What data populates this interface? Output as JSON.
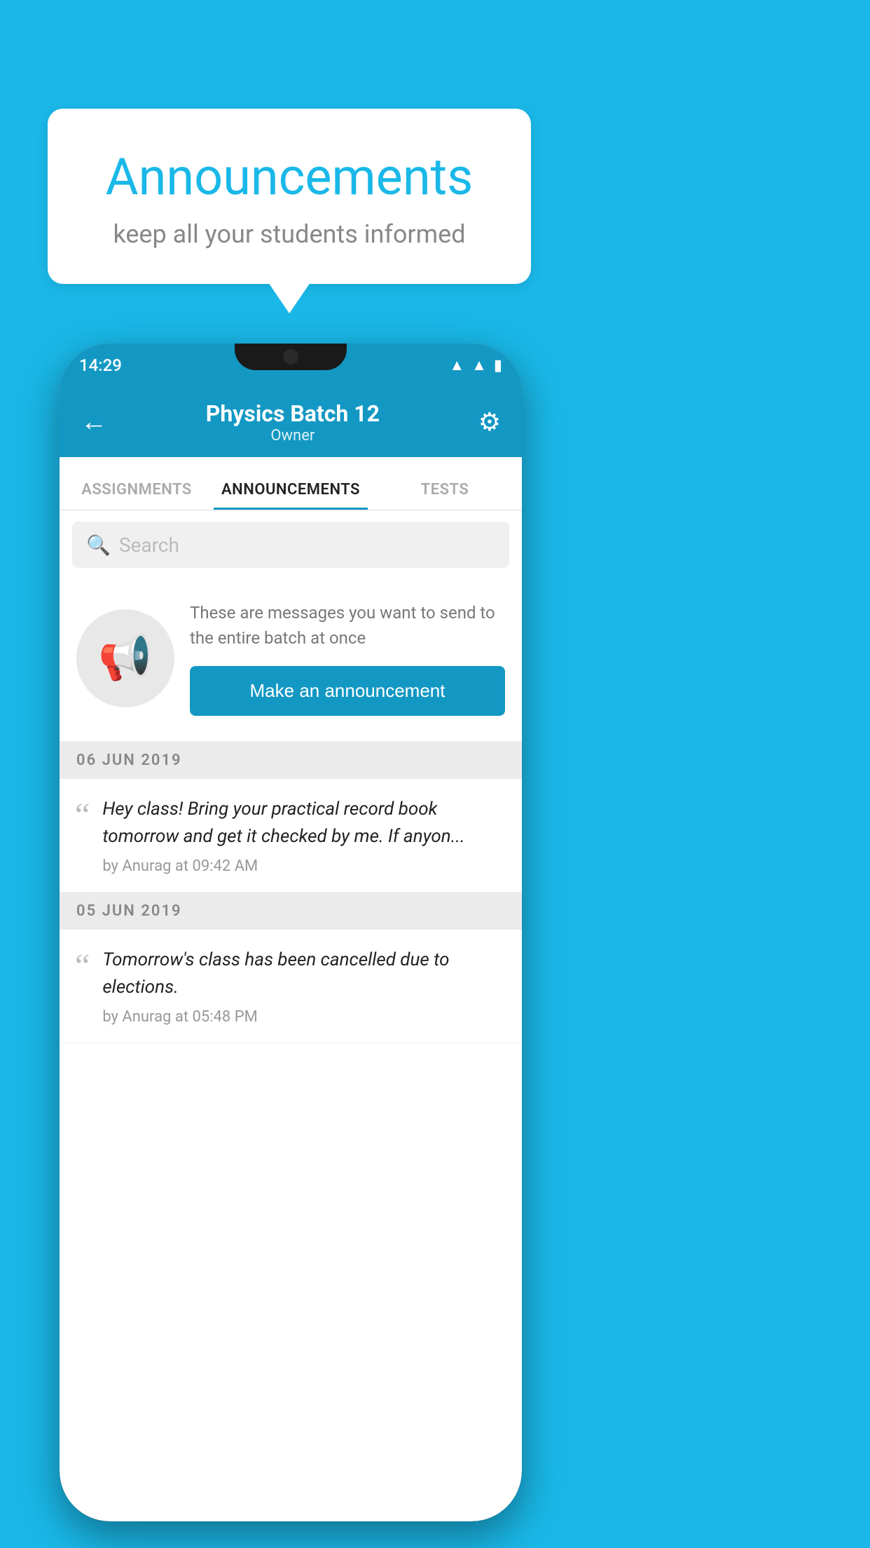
{
  "background_color": "#1ab8e8",
  "speech_bubble": {
    "title": "Announcements",
    "subtitle": "keep all your students informed"
  },
  "status_bar": {
    "time": "14:29",
    "icons": [
      "wifi",
      "signal",
      "battery"
    ]
  },
  "toolbar": {
    "back_icon": "←",
    "title": "Physics Batch 12",
    "subtitle": "Owner",
    "settings_icon": "⚙"
  },
  "tabs": [
    {
      "label": "ASSIGNMENTS",
      "active": false
    },
    {
      "label": "ANNOUNCEMENTS",
      "active": true
    },
    {
      "label": "TESTS",
      "active": false
    }
  ],
  "search": {
    "placeholder": "Search"
  },
  "promo": {
    "description": "These are messages you want to send to the entire batch at once",
    "button_label": "Make an announcement"
  },
  "announcements": [
    {
      "date": "06  JUN  2019",
      "message": "Hey class! Bring your practical record book tomorrow and get it checked by me. If anyon...",
      "meta": "by Anurag at 09:42 AM"
    },
    {
      "date": "05  JUN  2019",
      "message": "Tomorrow's class has been cancelled due to elections.",
      "meta": "by Anurag at 05:48 PM"
    }
  ]
}
